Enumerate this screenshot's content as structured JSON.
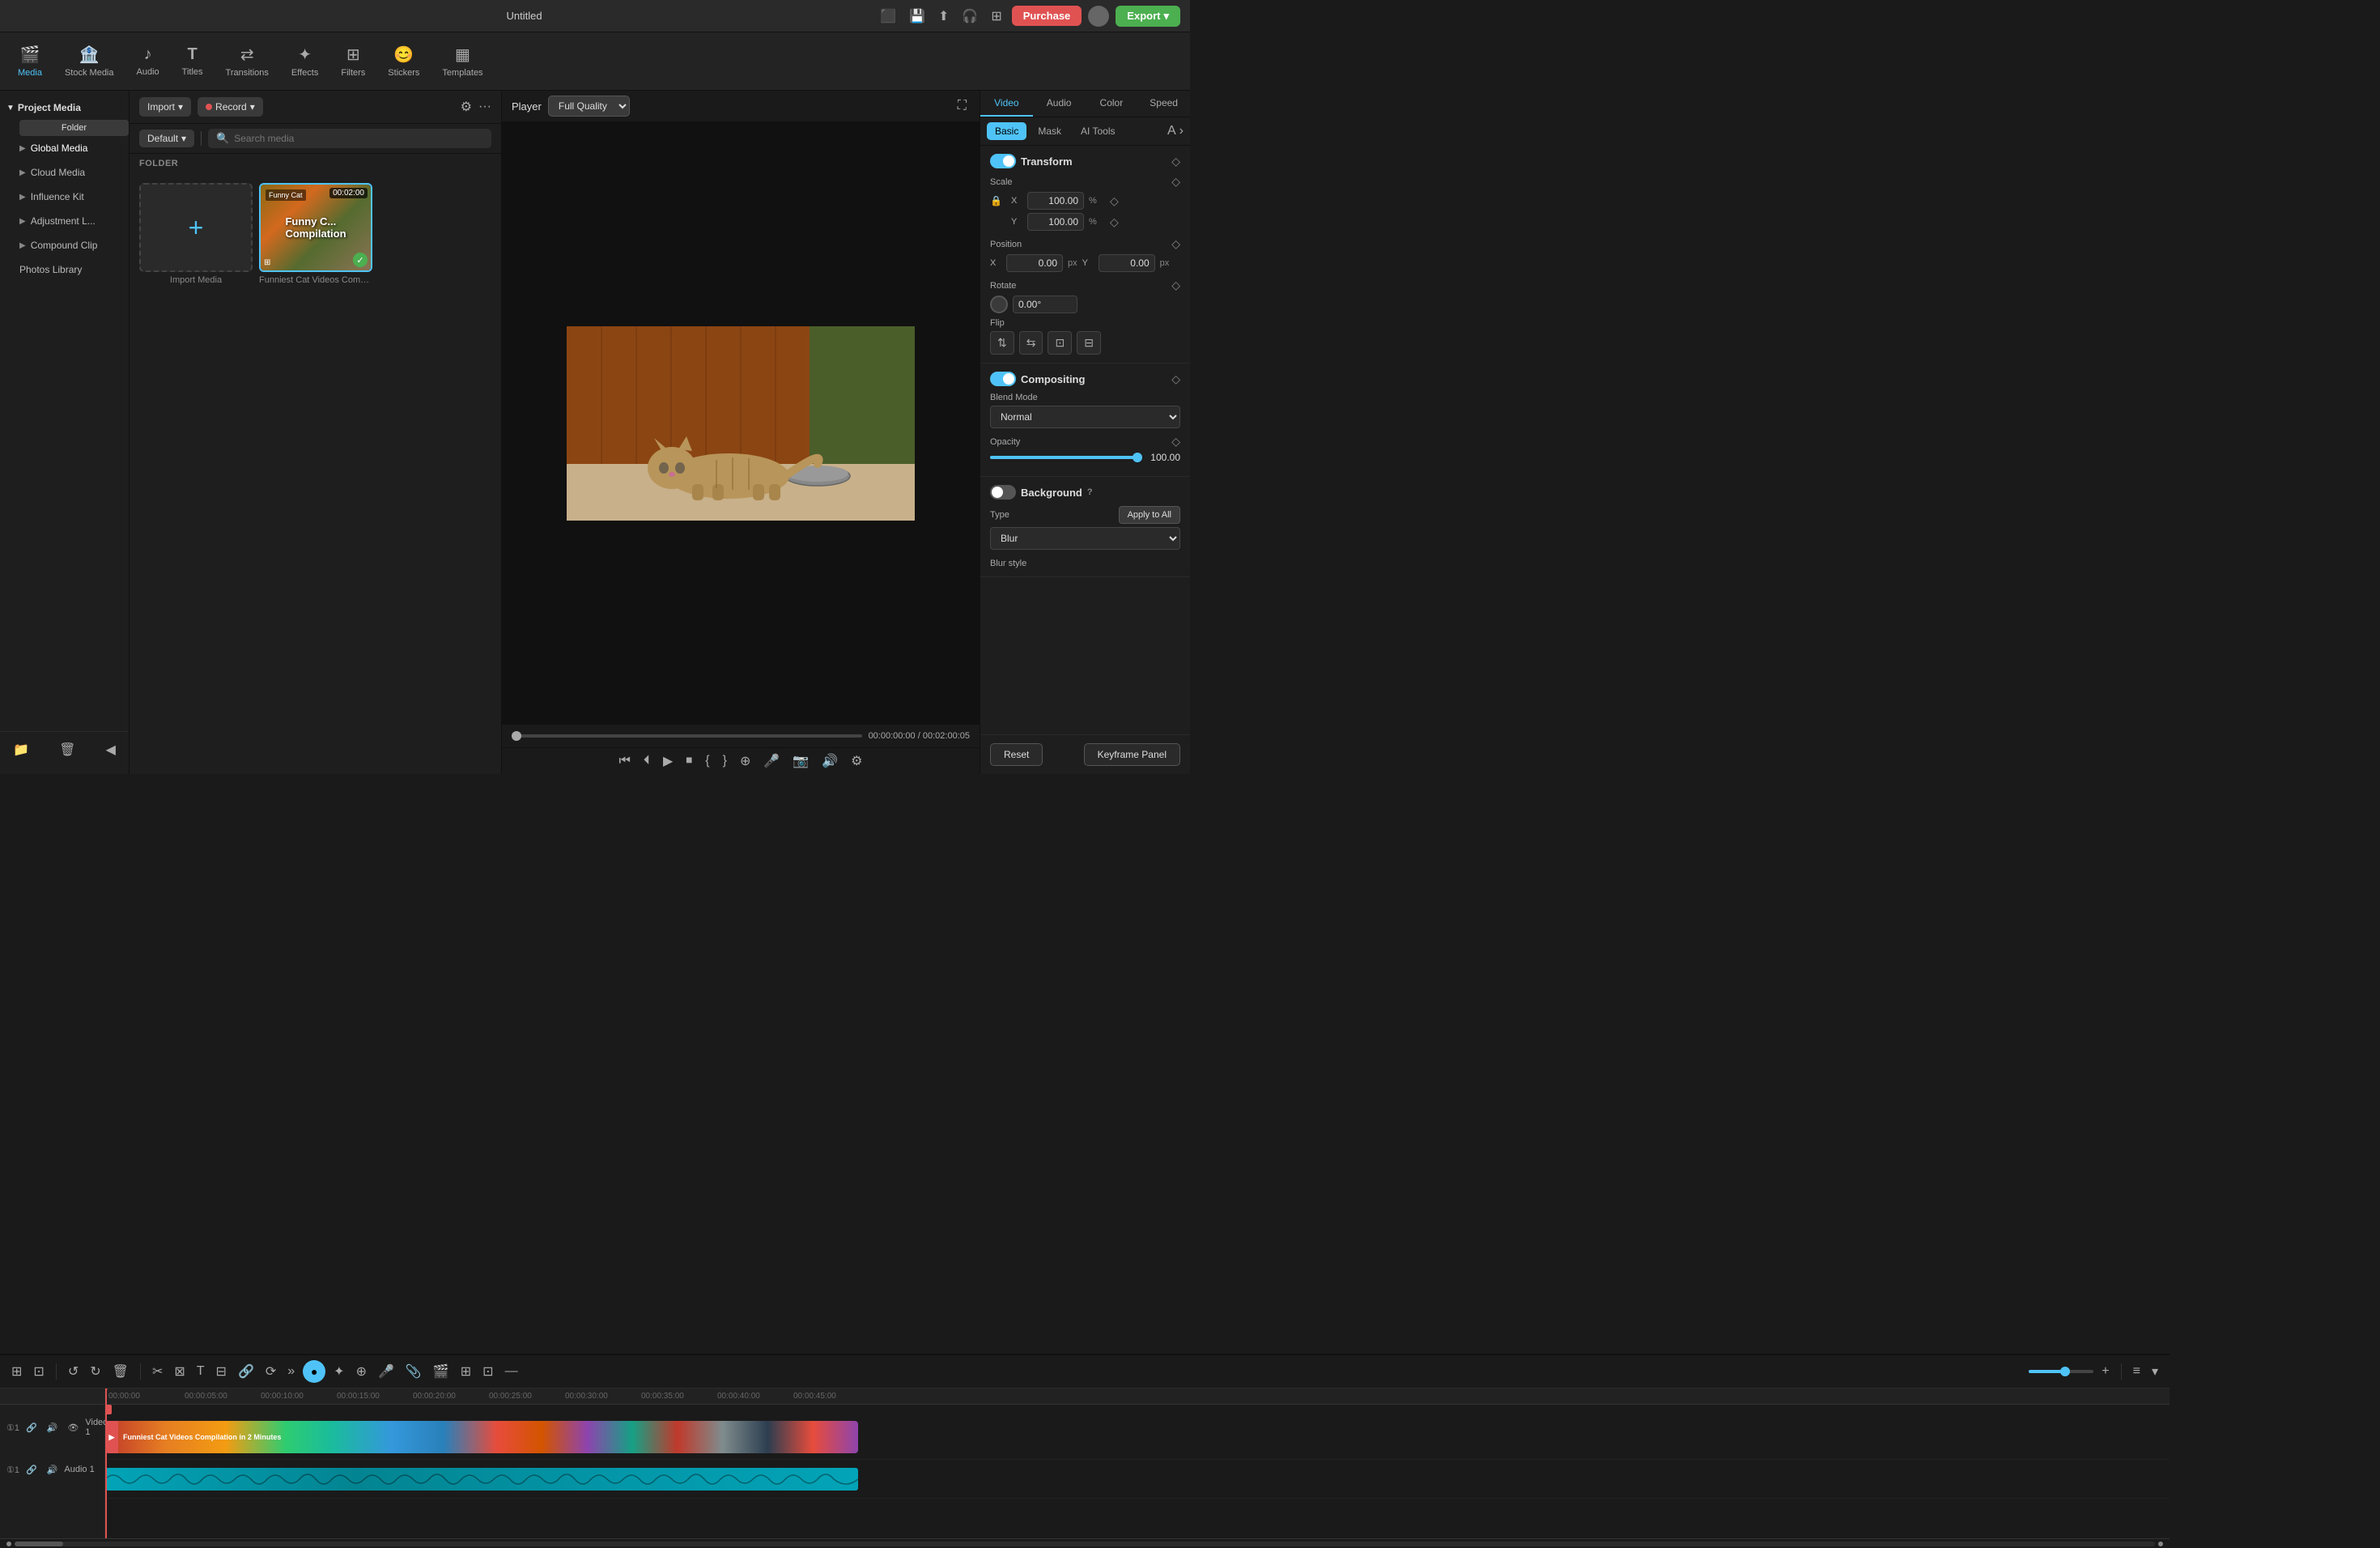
{
  "app": {
    "title": "Untitled"
  },
  "topbar": {
    "purchase_label": "Purchase",
    "export_label": "Export"
  },
  "media_tabs": [
    {
      "id": "media",
      "label": "Media",
      "icon": "🎬",
      "active": true
    },
    {
      "id": "stock",
      "label": "Stock Media",
      "icon": "🏦"
    },
    {
      "id": "audio",
      "label": "Audio",
      "icon": "♪"
    },
    {
      "id": "titles",
      "label": "Titles",
      "icon": "T"
    },
    {
      "id": "transitions",
      "label": "Transitions",
      "icon": "⇄"
    },
    {
      "id": "effects",
      "label": "Effects",
      "icon": "✦"
    },
    {
      "id": "filters",
      "label": "Filters",
      "icon": "⊞"
    },
    {
      "id": "stickers",
      "label": "Stickers",
      "icon": "😊"
    },
    {
      "id": "templates",
      "label": "Templates",
      "icon": "▦"
    }
  ],
  "left_panel": {
    "project_media_label": "Project Media",
    "folder_label": "Folder",
    "items": [
      {
        "label": "Global Media",
        "has_arrow": true
      },
      {
        "label": "Cloud Media",
        "has_arrow": true
      },
      {
        "label": "Influence Kit",
        "has_arrow": true
      },
      {
        "label": "Adjustment L...",
        "has_arrow": true
      },
      {
        "label": "Compound Clip",
        "has_arrow": true
      },
      {
        "label": "Photos Library",
        "has_arrow": false
      }
    ]
  },
  "media_panel": {
    "import_label": "Import",
    "record_label": "Record",
    "default_label": "Default",
    "search_placeholder": "Search media",
    "folder_label": "FOLDER",
    "items": [
      {
        "id": "import",
        "label": "Import Media",
        "type": "import"
      },
      {
        "id": "cat_video",
        "label": "Funniest Cat Videos Compi....",
        "type": "video",
        "duration": "00:02:00",
        "checked": true
      }
    ]
  },
  "player": {
    "label": "Player",
    "quality": "Full Quality",
    "time_current": "00:00:00:00",
    "time_separator": "/",
    "time_total": "00:02:00:05"
  },
  "right_panel": {
    "tabs": [
      {
        "label": "Video",
        "active": true
      },
      {
        "label": "Audio"
      },
      {
        "label": "Color"
      },
      {
        "label": "Speed"
      }
    ],
    "sub_tabs": [
      {
        "label": "Basic",
        "active": true
      },
      {
        "label": "Mask"
      },
      {
        "label": "AI Tools"
      }
    ],
    "transform": {
      "title": "Transform",
      "scale": {
        "label": "Scale",
        "x_label": "X",
        "x_value": "100.00",
        "y_label": "Y",
        "y_value": "100.00",
        "unit": "%"
      },
      "position": {
        "label": "Position",
        "x_label": "X",
        "x_value": "0.00",
        "x_unit": "px",
        "y_label": "Y",
        "y_value": "0.00",
        "y_unit": "px"
      },
      "rotate": {
        "label": "Rotate",
        "value": "0.00°"
      },
      "flip": {
        "label": "Flip"
      }
    },
    "compositing": {
      "title": "Compositing",
      "blend_mode": {
        "label": "Blend Mode",
        "value": "Normal"
      },
      "opacity": {
        "label": "Opacity",
        "value": "100.00",
        "percent": 100
      }
    },
    "background": {
      "title": "Background",
      "type_label": "Type",
      "apply_all_label": "Apply to All",
      "blur_value": "Blur",
      "blur_style_label": "Blur style"
    },
    "reset_label": "Reset",
    "keyframe_label": "Keyframe Panel"
  },
  "timeline": {
    "tracks": [
      {
        "id": "video1",
        "label": "Video 1",
        "type": "video",
        "content": "Funniest Cat Videos Compilation in 2 Minutes"
      },
      {
        "id": "audio1",
        "label": "Audio 1",
        "type": "audio"
      }
    ],
    "timestamps": [
      "00:00:00",
      "00:00:05:00",
      "00:00:10:00",
      "00:00:15:00",
      "00:00:20:00",
      "00:00:25:00",
      "00:00:30:00",
      "00:00:35:00",
      "00:00:40:00",
      "00:00:45:00"
    ]
  }
}
